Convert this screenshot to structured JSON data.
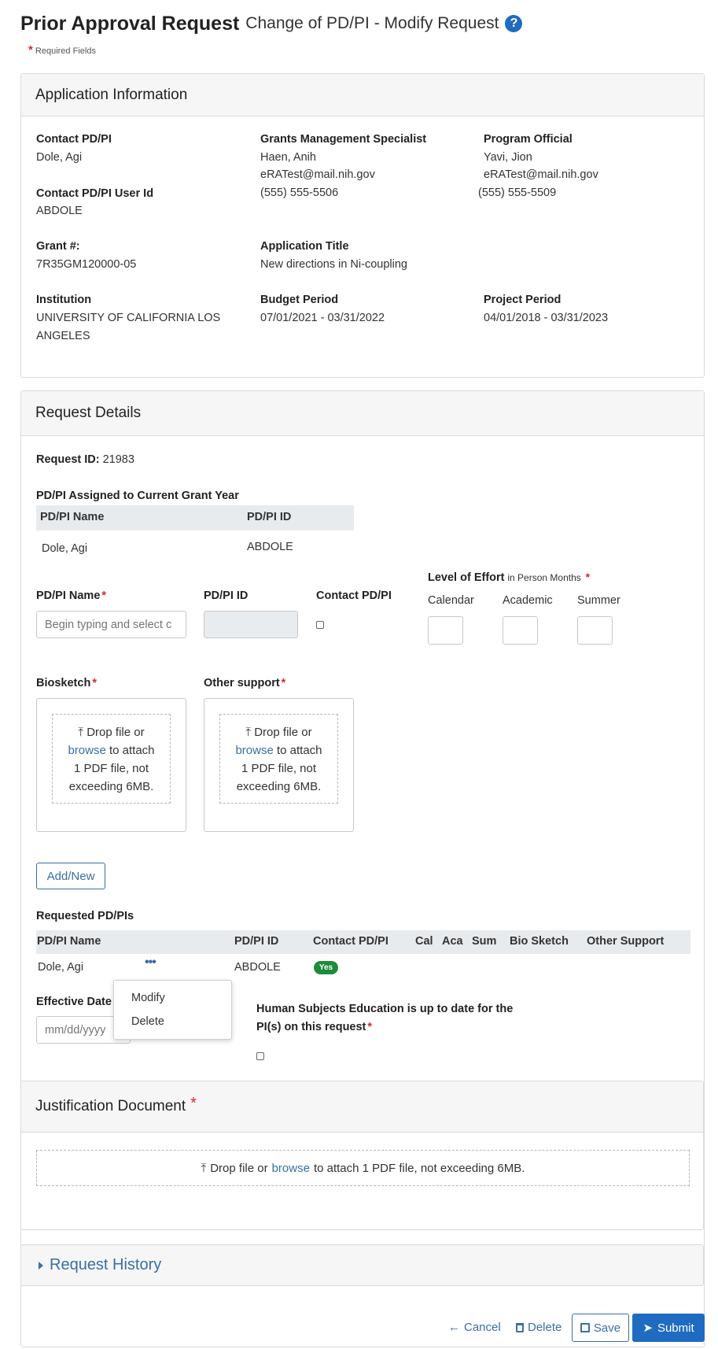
{
  "header": {
    "title": "Prior Approval Request",
    "subtitle": "Change of PD/PI - Modify Request",
    "required_note": "Required Fields",
    "asterisk": "*"
  },
  "app_info": {
    "heading": "Application Information",
    "contact_pdpi_label": "Contact PD/PI",
    "contact_pdpi": "Dole, Agi",
    "contact_user_label": "Contact PD/PI User Id",
    "contact_user": "ABDOLE",
    "gms_label": "Grants Management Specialist",
    "gms_name": "Haen, Anih",
    "gms_email": "eRATest@mail.nih.gov",
    "gms_phone": "(555) 555-5506",
    "po_label": "Program Official",
    "po_name": "Yavi, Jion",
    "po_email": "eRATest@mail.nih.gov",
    "po_phone": "(555) 555-5509",
    "grant_label": "Grant #:",
    "grant": "7R35GM120000-05",
    "app_title_label": "Application Title",
    "app_title": "New directions in Ni-coupling",
    "institution_label": "Institution",
    "institution_line1": "UNIVERSITY OF CALIFORNIA LOS",
    "institution_line2": "ANGELES",
    "budget_label": "Budget Period",
    "budget": "07/01/2021 - 03/31/2022",
    "project_label": "Project Period",
    "project": "04/01/2018 - 03/31/2023"
  },
  "request": {
    "heading": "Request Details",
    "request_id_label": "Request ID:",
    "request_id": "21983",
    "assigned_label": "PD/PI Assigned to Current Grant Year",
    "assigned_headers": [
      "PD/PI Name",
      "PD/PI ID"
    ],
    "assigned_row": [
      "Dole, Agi",
      "ABDOLE"
    ],
    "pdpi_name_label": "PD/PI Name",
    "pdpi_name_placeholder": "Begin typing and select c",
    "pdpi_id_label": "PD/PI ID",
    "contact_label": "Contact PD/PI",
    "effort_label": "Level of Effort",
    "effort_sub": "in Person Months",
    "calendar": "Calendar",
    "academic": "Academic",
    "summer": "Summer",
    "biosketch_label": "Biosketch",
    "other_support_label": "Other support",
    "drop1_a": "Drop file or",
    "drop1_browse": "browse",
    "drop1_b": "to attach",
    "drop1_c": "1 PDF file, not",
    "drop1_d": "exceeding 6MB.",
    "add_new": "Add/New",
    "requested_label": "Requested PD/PIs",
    "requested_headers": [
      "PD/PI Name",
      "PD/PI ID",
      "Contact PD/PI",
      "Cal",
      "Aca",
      "Sum",
      "Bio Sketch",
      "Other Support"
    ],
    "requested_row": {
      "name": "Dole, Agi",
      "id": "ABDOLE",
      "contact": "Yes"
    },
    "menu_modify": "Modify",
    "menu_delete": "Delete",
    "effective_label": "Effective Date",
    "effective_placeholder": "mm/dd/yyyy",
    "hse_line1": "Human Subjects Education is up to date for the",
    "hse_line2": "PI(s) on this request"
  },
  "justification": {
    "heading": "Justification Document",
    "drop_a": "Drop file or",
    "drop_browse": "browse",
    "drop_b": "to attach 1 PDF file, not exceeding 6MB."
  },
  "history": {
    "heading": "Request History"
  },
  "actions": {
    "cancel": "Cancel",
    "delete": "Delete",
    "save": "Save",
    "submit": "Submit"
  },
  "colors": {
    "accent": "#3a6ea8",
    "required": "#d9272e",
    "submit_bg": "#1f6bc2",
    "yes_badge": "#1e8a3a"
  }
}
